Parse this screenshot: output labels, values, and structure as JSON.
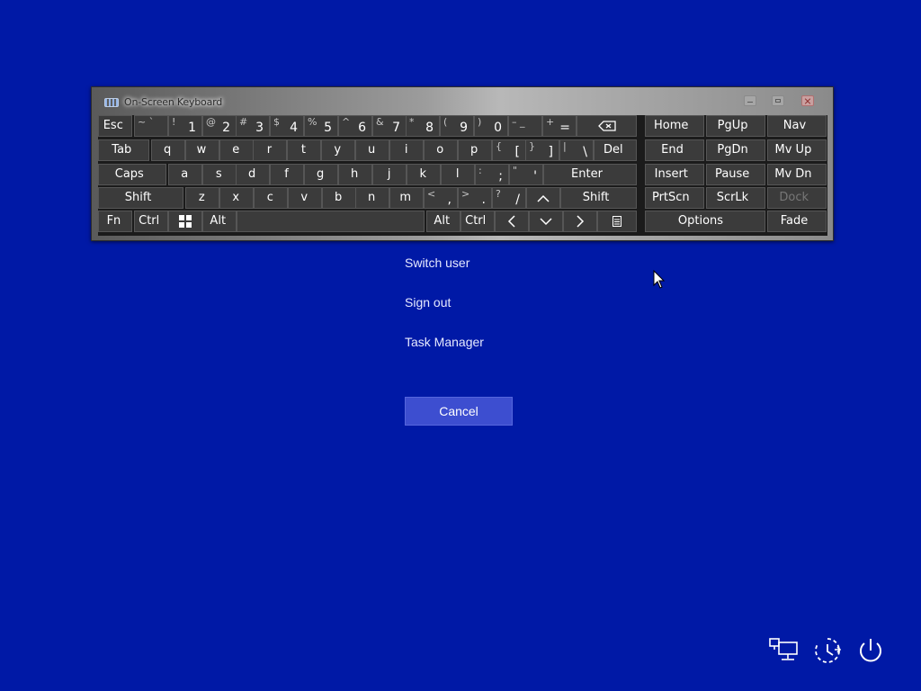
{
  "keyboard": {
    "title": "On-Screen Keyboard",
    "rows": [
      [
        {
          "type": "single",
          "label": "Esc"
        },
        {
          "type": "dual",
          "hi": "~ `",
          "lo": ""
        },
        {
          "type": "dual",
          "hi": "!",
          "lo": "1"
        },
        {
          "type": "dual",
          "hi": "@",
          "lo": "2"
        },
        {
          "type": "dual",
          "hi": "#",
          "lo": "3"
        },
        {
          "type": "dual",
          "hi": "$",
          "lo": "4"
        },
        {
          "type": "dual",
          "hi": "%",
          "lo": "5"
        },
        {
          "type": "dual",
          "hi": "^",
          "lo": "6"
        },
        {
          "type": "dual",
          "hi": "&",
          "lo": "7"
        },
        {
          "type": "dual",
          "hi": "*",
          "lo": "8"
        },
        {
          "type": "dual",
          "hi": "(",
          "lo": "9"
        },
        {
          "type": "dual",
          "hi": ")",
          "lo": "0"
        },
        {
          "type": "dual",
          "hi": "– _",
          "lo": ""
        },
        {
          "type": "dual",
          "hi": "+",
          "lo": "="
        },
        {
          "type": "icon",
          "icon": "backspace-icon"
        },
        {
          "type": "single",
          "label": "Home"
        },
        {
          "type": "single",
          "label": "PgUp"
        },
        {
          "type": "single",
          "label": "Nav"
        }
      ],
      [
        {
          "type": "single",
          "label": "Tab"
        },
        {
          "type": "single",
          "label": "q"
        },
        {
          "type": "single",
          "label": "w"
        },
        {
          "type": "single",
          "label": "e"
        },
        {
          "type": "single",
          "label": "r"
        },
        {
          "type": "single",
          "label": "t"
        },
        {
          "type": "single",
          "label": "y"
        },
        {
          "type": "single",
          "label": "u"
        },
        {
          "type": "single",
          "label": "i"
        },
        {
          "type": "single",
          "label": "o"
        },
        {
          "type": "single",
          "label": "p"
        },
        {
          "type": "dual",
          "hi": "{",
          "lo": "["
        },
        {
          "type": "dual",
          "hi": "}",
          "lo": "]"
        },
        {
          "type": "dual",
          "hi": "|",
          "lo": "\\"
        },
        {
          "type": "single",
          "label": "Del"
        },
        {
          "type": "single",
          "label": "End"
        },
        {
          "type": "single",
          "label": "PgDn"
        },
        {
          "type": "single",
          "label": "Mv Up"
        }
      ],
      [
        {
          "type": "single",
          "label": "Caps"
        },
        {
          "type": "single",
          "label": "a"
        },
        {
          "type": "single",
          "label": "s"
        },
        {
          "type": "single",
          "label": "d"
        },
        {
          "type": "single",
          "label": "f"
        },
        {
          "type": "single",
          "label": "g"
        },
        {
          "type": "single",
          "label": "h"
        },
        {
          "type": "single",
          "label": "j"
        },
        {
          "type": "single",
          "label": "k"
        },
        {
          "type": "single",
          "label": "l"
        },
        {
          "type": "dual",
          "hi": ":",
          "lo": ";"
        },
        {
          "type": "dual",
          "hi": "\"",
          "lo": "'"
        },
        {
          "type": "single",
          "label": "Enter"
        },
        {
          "type": "single",
          "label": "Insert"
        },
        {
          "type": "single",
          "label": "Pause"
        },
        {
          "type": "single",
          "label": "Mv Dn"
        }
      ],
      [
        {
          "type": "single",
          "label": "Shift"
        },
        {
          "type": "single",
          "label": "z"
        },
        {
          "type": "single",
          "label": "x"
        },
        {
          "type": "single",
          "label": "c"
        },
        {
          "type": "single",
          "label": "v"
        },
        {
          "type": "single",
          "label": "b"
        },
        {
          "type": "single",
          "label": "n"
        },
        {
          "type": "single",
          "label": "m"
        },
        {
          "type": "dual",
          "hi": "<",
          "lo": ","
        },
        {
          "type": "dual",
          "hi": ">",
          "lo": "."
        },
        {
          "type": "dual",
          "hi": "?",
          "lo": "/"
        },
        {
          "type": "icon",
          "icon": "arrow-up-icon"
        },
        {
          "type": "single",
          "label": "Shift"
        },
        {
          "type": "single",
          "label": "PrtScn"
        },
        {
          "type": "single",
          "label": "ScrLk"
        },
        {
          "type": "single",
          "label": "Dock",
          "disabled": true
        }
      ],
      [
        {
          "type": "single",
          "label": "Fn"
        },
        {
          "type": "single",
          "label": "Ctrl"
        },
        {
          "type": "icon",
          "icon": "windows-icon"
        },
        {
          "type": "single",
          "label": "Alt"
        },
        {
          "type": "single",
          "label": ""
        },
        {
          "type": "single",
          "label": "Alt"
        },
        {
          "type": "single",
          "label": "Ctrl"
        },
        {
          "type": "icon",
          "icon": "arrow-left-icon"
        },
        {
          "type": "icon",
          "icon": "arrow-down-icon"
        },
        {
          "type": "icon",
          "icon": "arrow-right-icon"
        },
        {
          "type": "icon",
          "icon": "menu-key-icon"
        },
        {
          "type": "single",
          "label": "Options"
        },
        {
          "type": "single",
          "label": "Fade"
        }
      ]
    ]
  },
  "menu": {
    "switch_user": "Switch user",
    "sign_out": "Sign out",
    "task_manager": "Task Manager",
    "cancel": "Cancel"
  },
  "corner_icons": [
    "network-icon",
    "ease-of-access-icon",
    "power-icon"
  ],
  "colors": {
    "background": "#0019a6",
    "cancel_button": "#3d4ed0",
    "key_face": "#3b3b3b"
  }
}
